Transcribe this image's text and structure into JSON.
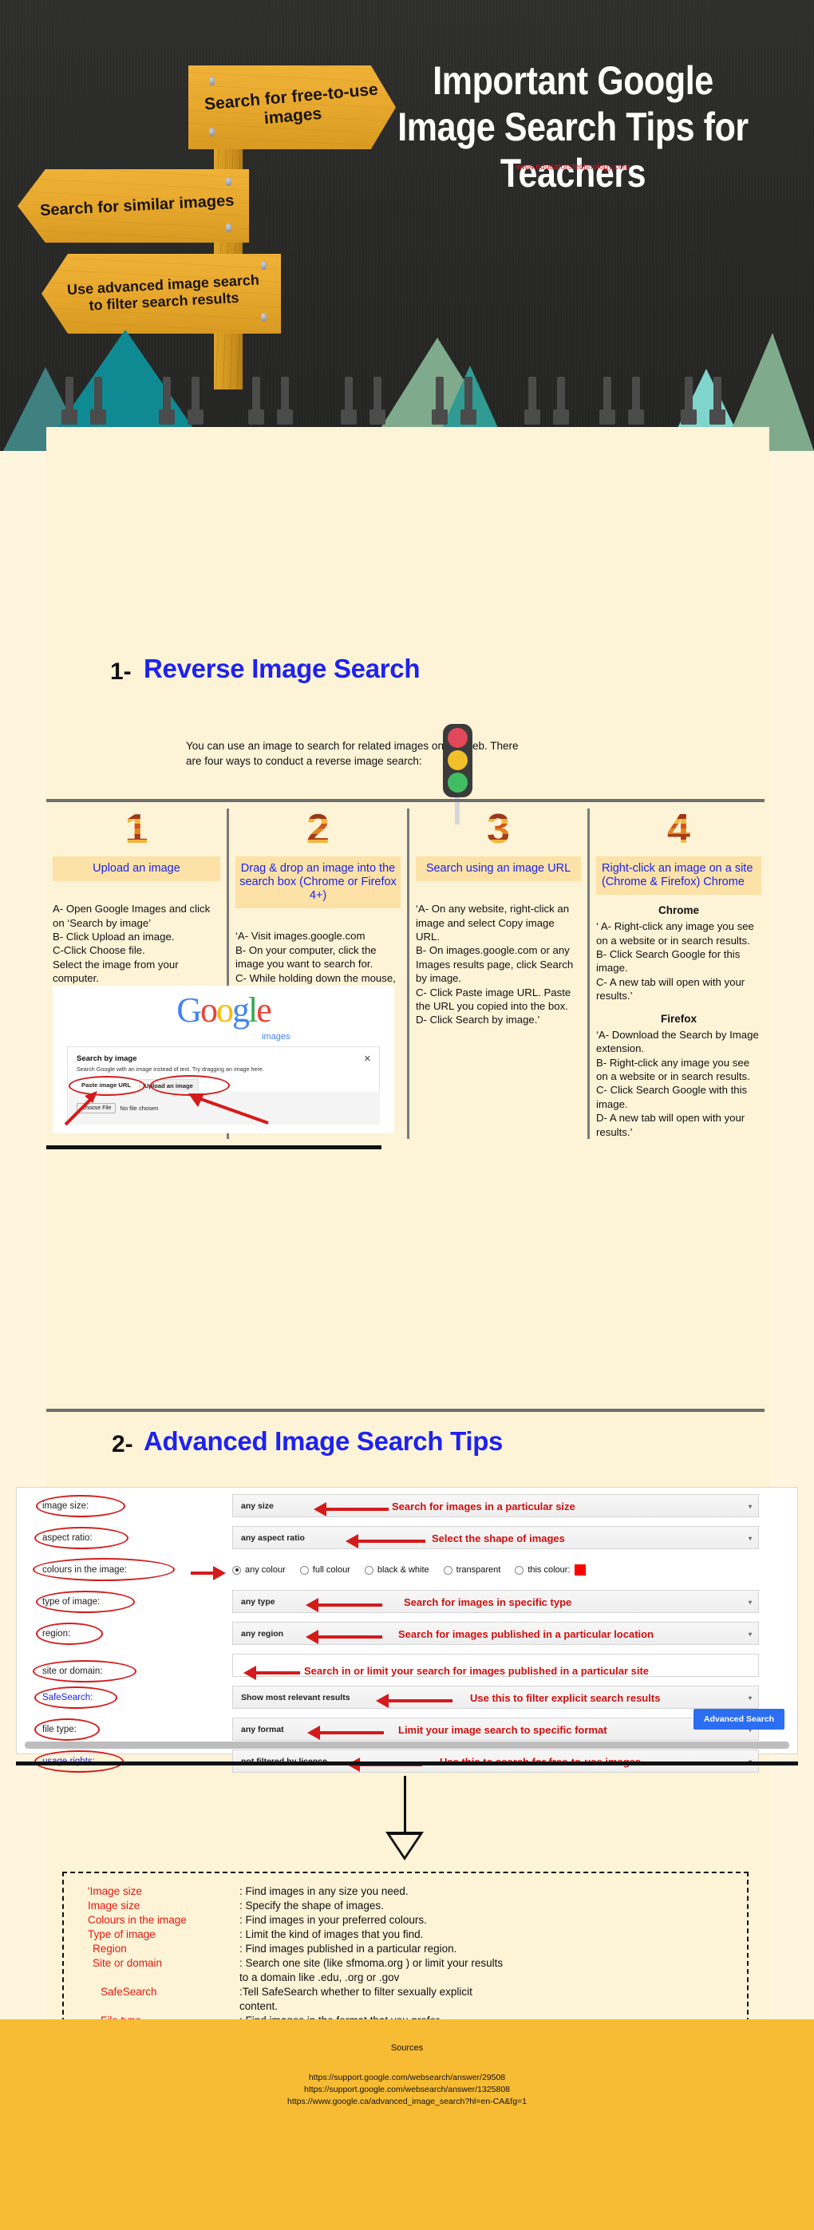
{
  "hero": {
    "title": "Important  Google Image Search Tips for Teachers",
    "website": "www.educatorstechnology.com",
    "signs": [
      {
        "text": "Search for free-to-use images"
      },
      {
        "text": "Search for similar images"
      },
      {
        "text": "Use advanced image search to filter search results"
      }
    ]
  },
  "section1": {
    "number": "1-",
    "title": "Reverse Image Search",
    "intro": "You can use an image to search for related images on the web. There are four ways to conduct a reverse image search:",
    "columns": [
      {
        "number": "1",
        "label": "Upload an image",
        "body": "A- Open Google Images and click on ‘Search by image’\nB- Click Upload an image.\nC-Click Choose file.\nSelect the image from your computer."
      },
      {
        "number": "2",
        "label": "Drag & drop an image into the search box (Chrome or Firefox 4+)",
        "body": "‘A- Visit images.google.com\nB- On your computer, click the image you want to search for.\nC- While holding down the mouse, drag the image into the search box.’"
      },
      {
        "number": "3",
        "label": "Search using an image URL",
        "body": "‘A- On any website, right-click an image and select Copy image URL.\nB- On images.google.com or any Images results page, click Search by image.\nC- Click Paste image URL. Paste the URL you copied into the box.\nD- Click Search by image.’"
      },
      {
        "number": "4",
        "label": "Right-click an image on a site (Chrome & Firefox) Chrome",
        "sub1": "Chrome",
        "body1": "‘ A- Right-click any image you see on a website or in search results.\nB- Click Search Google for this image.\nC- A new tab will open with your results.’",
        "sub2": "Firefox",
        "body2": "‘A- Download the Search by Image extension.\nB- Right-click any image you see on a website or in search results.\nC- Click Search Google with this image.\nD- A new tab will open with your results.’"
      }
    ],
    "google_shot": {
      "logo": "Google",
      "logo_sub": "images",
      "card_title": "Search by image",
      "card_desc": "Search Google with an image instead of text. Try dragging an image here.",
      "close": "✕",
      "tab_paste": "Paste image URL",
      "tab_upload": "Upload an image",
      "choose_file_btn": "Choose File",
      "no_file_text": "No file chosen"
    }
  },
  "section2": {
    "number": "2-",
    "title": "Advanced Image Search Tips",
    "rows": [
      {
        "label": "image size:",
        "value": "any size",
        "annotation": "Search for images in a particular size",
        "type": "select"
      },
      {
        "label": "aspect ratio:",
        "value": "any aspect ratio",
        "annotation": "Select the shape of images",
        "type": "select"
      },
      {
        "label": "colours in the image:",
        "value": "",
        "annotation": "",
        "type": "radios"
      },
      {
        "label": "type of image:",
        "value": "any type",
        "annotation": "Search for images in specific type",
        "type": "select"
      },
      {
        "label": "region:",
        "value": "any region",
        "annotation": "Search for images published in a particular location",
        "type": "select"
      },
      {
        "label": "site or domain:",
        "value": "",
        "annotation": "Search in or limit your search for images published in a particular site",
        "type": "text"
      },
      {
        "label": "SafeSearch:",
        "value": "Show most relevant results",
        "annotation": "Use this to filter explicit search results",
        "type": "select",
        "blue": true
      },
      {
        "label": "file type:",
        "value": "any format",
        "annotation": "Limit your image search to specific format",
        "type": "select"
      },
      {
        "label": "usage rights:",
        "value": "not filtered by licence",
        "annotation": "Use this to search for free-to-use images",
        "type": "select",
        "blue": true
      }
    ],
    "colour_options": [
      {
        "label": "any colour",
        "selected": true
      },
      {
        "label": "full colour",
        "selected": false
      },
      {
        "label": "black & white",
        "selected": false
      },
      {
        "label": "transparent",
        "selected": false
      },
      {
        "label": "this colour:",
        "selected": false,
        "swatch": "#ff0000"
      }
    ],
    "submit_button": "Advanced Search"
  },
  "definitions": [
    {
      "term": "'Image size",
      "desc": ": Find images in any size you need."
    },
    {
      "term": "Image size",
      "desc": ": Specify the shape of images."
    },
    {
      "term": "Colours in the image",
      "desc": ": Find images in your preferred colours."
    },
    {
      "term": "Type of image",
      "desc": ": Limit the kind of images that you find."
    },
    {
      "term": "Region",
      "desc": ": Find images published in a particular region."
    },
    {
      "term": "Site or domain",
      "desc": ": Search one site (like   sfmoma.org ) or limit your results\nto a domain like  .edu, .org or .gov"
    },
    {
      "term": "SafeSearch",
      "desc": ":Tell SafeSearch whether to filter sexually explicit\ncontent."
    },
    {
      "term": "File type",
      "desc": ": Find images in the format that you prefer.\nUsage rights: Find images that you are free to use.'"
    }
  ],
  "footer": {
    "heading": "Sources",
    "sources": "https://support.google.com/websearch/answer/29508\nhttps://support.google.com/websearch/answer/1325808\nhttps://www.google.ca/advanced_image_search?hl=en-CA&fg=1"
  }
}
